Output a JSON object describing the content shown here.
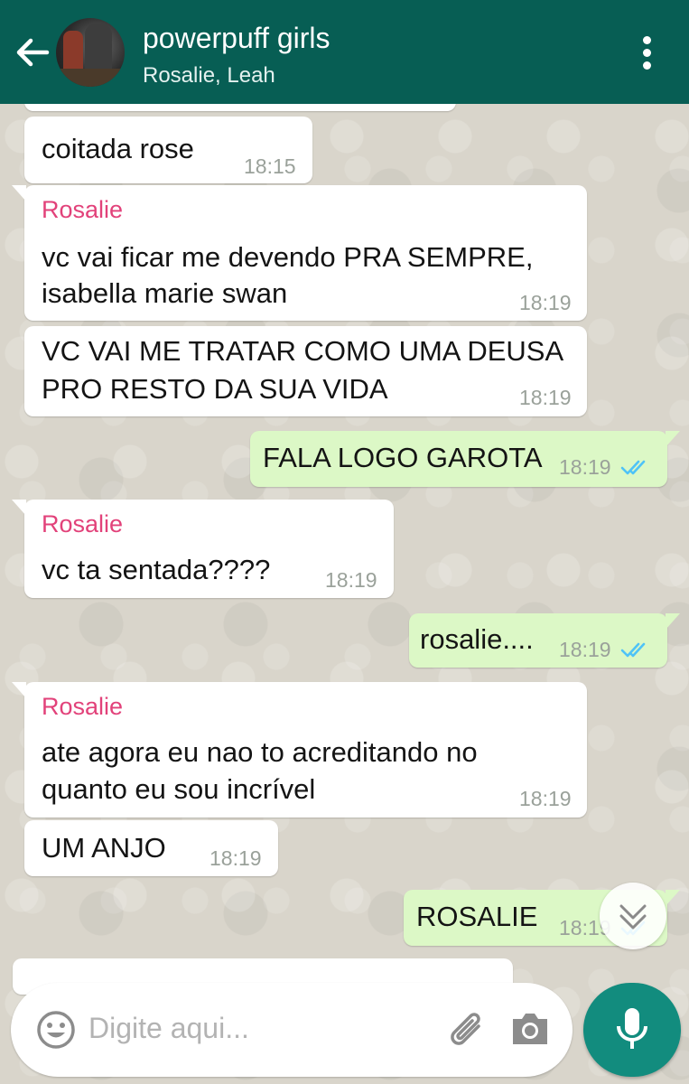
{
  "header": {
    "title": "powerpuff girls",
    "subtitle": "Rosalie, Leah"
  },
  "messages": [
    {
      "type": "incoming",
      "text": "coitada rose",
      "time": "18:15"
    },
    {
      "type": "incoming",
      "sender": "Rosalie",
      "lines": [
        "vc vai ficar me devendo PRA SEMPRE,",
        "isabella marie swan"
      ],
      "time": "18:19"
    },
    {
      "type": "incoming",
      "lines": [
        "VC VAI ME TRATAR COMO UMA DEUSA",
        "PRO RESTO DA SUA VIDA"
      ],
      "time": "18:19"
    },
    {
      "type": "outgoing",
      "text": "FALA LOGO GAROTA",
      "time": "18:19",
      "status": "read"
    },
    {
      "type": "incoming",
      "sender": "Rosalie",
      "text": "vc ta sentada????",
      "time": "18:19"
    },
    {
      "type": "outgoing",
      "text": "rosalie....",
      "time": "18:19",
      "status": "read"
    },
    {
      "type": "incoming",
      "sender": "Rosalie",
      "lines": [
        "ate agora eu nao to acreditando no",
        "quanto eu sou incrível"
      ],
      "time": "18:19"
    },
    {
      "type": "incoming",
      "text": "UM ANJO",
      "time": "18:19"
    },
    {
      "type": "outgoing",
      "text": "ROSALIE",
      "time": "18:19",
      "status": "read"
    }
  ],
  "input": {
    "placeholder": "Digite aqui..."
  },
  "colors": {
    "header": "#075e54",
    "sender_name": "#e2427a",
    "outgoing_bubble": "#dcf8c6",
    "read_ticks": "#4fc3f7",
    "mic_button": "#128c7e"
  },
  "icons": [
    "back-arrow-icon",
    "more-vert-icon",
    "emoji-icon",
    "attach-icon",
    "camera-icon",
    "mic-icon",
    "scroll-down-icon",
    "double-check-icon"
  ]
}
